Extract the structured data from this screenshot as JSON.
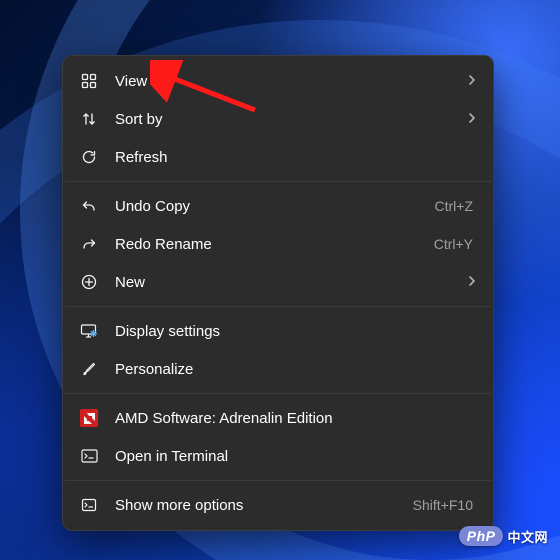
{
  "menu": {
    "view": {
      "label": "View",
      "submenu": true
    },
    "sortby": {
      "label": "Sort by",
      "submenu": true
    },
    "refresh": {
      "label": "Refresh"
    },
    "undo": {
      "label": "Undo Copy",
      "shortcut": "Ctrl+Z"
    },
    "redo": {
      "label": "Redo Rename",
      "shortcut": "Ctrl+Y"
    },
    "new": {
      "label": "New",
      "submenu": true
    },
    "display": {
      "label": "Display settings"
    },
    "personalize": {
      "label": "Personalize"
    },
    "amd": {
      "label": "AMD Software: Adrenalin Edition"
    },
    "terminal": {
      "label": "Open in Terminal"
    },
    "more": {
      "label": "Show more options",
      "shortcut": "Shift+F10"
    }
  },
  "watermark": {
    "badge": "PhP",
    "text": "中文网"
  }
}
